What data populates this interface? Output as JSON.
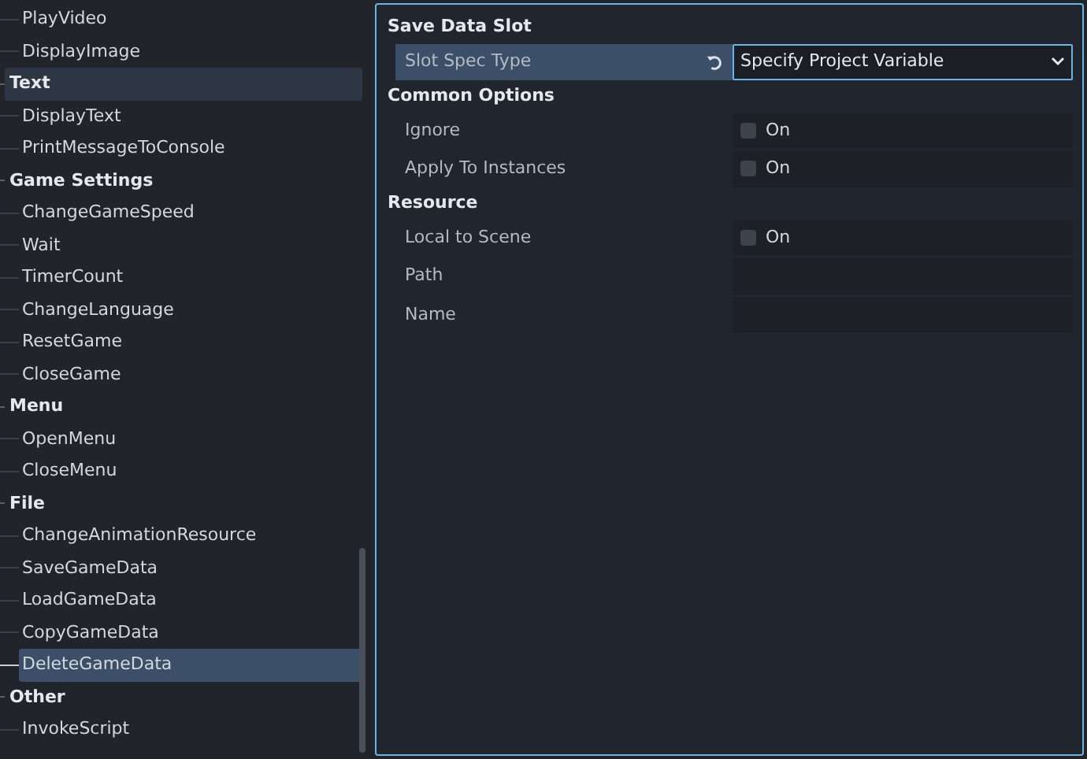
{
  "tree": [
    {
      "children": [
        {
          "label": "PlayVideo",
          "selected": false
        },
        {
          "label": "DisplayImage",
          "selected": false
        }
      ]
    },
    {
      "label": "Text",
      "hovered": true,
      "children": [
        {
          "label": "DisplayText",
          "selected": false
        },
        {
          "label": "PrintMessageToConsole",
          "selected": false
        }
      ]
    },
    {
      "label": "Game Settings",
      "hovered": false,
      "children": [
        {
          "label": "ChangeGameSpeed",
          "selected": false
        },
        {
          "label": "Wait",
          "selected": false
        },
        {
          "label": "TimerCount",
          "selected": false
        },
        {
          "label": "ChangeLanguage",
          "selected": false
        },
        {
          "label": "ResetGame",
          "selected": false
        },
        {
          "label": "CloseGame",
          "selected": false
        }
      ]
    },
    {
      "label": "Menu",
      "hovered": false,
      "children": [
        {
          "label": "OpenMenu",
          "selected": false
        },
        {
          "label": "CloseMenu",
          "selected": false
        }
      ]
    },
    {
      "label": "File",
      "hovered": false,
      "children": [
        {
          "label": "ChangeAnimationResource",
          "selected": false
        },
        {
          "label": "SaveGameData",
          "selected": false
        },
        {
          "label": "LoadGameData",
          "selected": false
        },
        {
          "label": "CopyGameData",
          "selected": false
        },
        {
          "label": "DeleteGameData",
          "selected": true
        }
      ]
    },
    {
      "label": "Other",
      "hovered": false,
      "children": [
        {
          "label": "InvokeScript",
          "selected": false
        }
      ]
    }
  ],
  "inspector": {
    "sections": [
      {
        "title": "Save Data Slot",
        "properties": [
          {
            "kind": "dropdown",
            "label": "Slot Spec Type",
            "value": "Specify Project Variable",
            "selected": true,
            "revertable": true
          }
        ]
      },
      {
        "title": "Common Options",
        "properties": [
          {
            "kind": "checkbox",
            "label": "Ignore",
            "value": "On",
            "checked": false,
            "selected": false
          },
          {
            "kind": "checkbox",
            "label": "Apply To Instances",
            "value": "On",
            "checked": false,
            "selected": false
          }
        ]
      },
      {
        "title": "Resource",
        "properties": [
          {
            "kind": "checkbox",
            "label": "Local to Scene",
            "value": "On",
            "checked": false,
            "selected": false
          },
          {
            "kind": "text",
            "label": "Path",
            "selected": false
          },
          {
            "kind": "text",
            "label": "Name",
            "selected": false
          }
        ]
      }
    ]
  }
}
